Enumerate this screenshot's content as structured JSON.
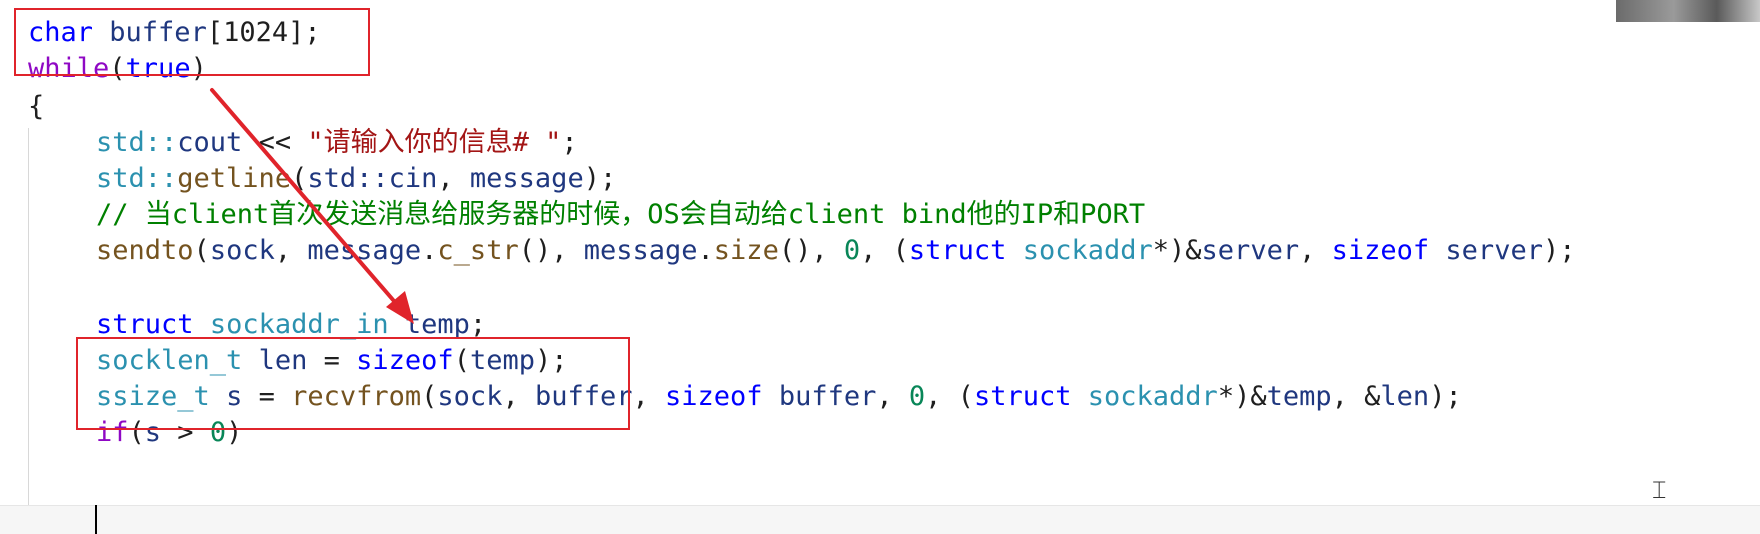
{
  "code": {
    "l1": [
      "char",
      " buffer",
      "[1024];"
    ],
    "l2": [
      "while",
      "(",
      "true",
      ")"
    ],
    "l3": [
      "{"
    ],
    "l4": [
      "std::",
      "cout",
      " << ",
      "\"请输入你的信息# \"",
      ";"
    ],
    "l5": [
      "std::",
      "getline",
      "(",
      "std::cin",
      ", ",
      "message",
      ");"
    ],
    "l6": [
      "// 当client首次发送消息给服务器的时候，OS会自动给client bind他的IP和PORT"
    ],
    "l7": [
      "sendto",
      "(",
      "sock",
      ", ",
      "message",
      ".",
      "c_str",
      "(), ",
      "message",
      ".",
      "size",
      "(), ",
      "0",
      ", (",
      "struct",
      " ",
      "sockaddr",
      "*)&",
      "server",
      ", ",
      "sizeof",
      " ",
      "server",
      ");"
    ],
    "l9": [
      "struct",
      " ",
      "sockaddr_in",
      " ",
      "temp",
      ";"
    ],
    "l10": [
      "socklen_t",
      " ",
      "len",
      " = ",
      "sizeof",
      "(",
      "temp",
      ");"
    ],
    "l11": [
      "ssize_t",
      " ",
      "s",
      " = ",
      "recvfrom",
      "(",
      "sock",
      ", ",
      "buffer",
      ", ",
      "sizeof",
      " ",
      "buffer",
      ", ",
      "0",
      ", (",
      "struct",
      " ",
      "sockaddr",
      "*)&",
      "temp",
      ", &",
      "len",
      ");"
    ],
    "l12": [
      "if",
      "(",
      "s",
      " > ",
      "0",
      ")"
    ]
  },
  "cursor_icon": "text-ibeam-icon",
  "annotation_color": "#e0242b"
}
